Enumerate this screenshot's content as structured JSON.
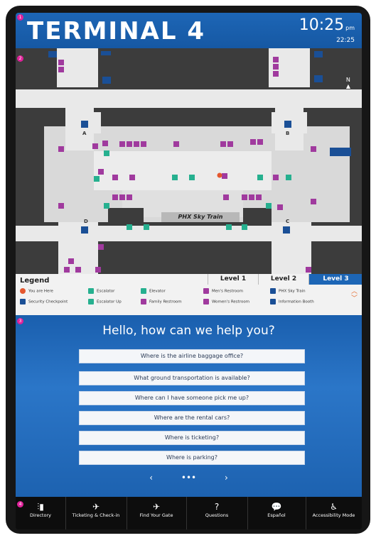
{
  "header": {
    "title": "TERMINAL 4",
    "time": "10:25",
    "ampm": "pm",
    "alt_time": "22:25"
  },
  "markers": [
    "1",
    "2",
    "3",
    "4"
  ],
  "map": {
    "north_label": "N",
    "gates": [
      "A",
      "B",
      "C",
      "D"
    ],
    "ski_store_label": "PHX Sky Train"
  },
  "legend": {
    "title": "Legend",
    "levels": [
      "Level 1",
      "Level 2",
      "Level 3"
    ],
    "active_level": "Level 3",
    "items": [
      {
        "label": "You are Here",
        "color": "#e4572e",
        "icon": "pin-icon"
      },
      {
        "label": "Escalator",
        "color": "#26b08f",
        "icon": "escalator-icon"
      },
      {
        "label": "Elevator",
        "color": "#26b08f",
        "icon": "elevator-icon"
      },
      {
        "label": "Men's Restroom",
        "color": "#a03a9e",
        "icon": "mens-restroom-icon"
      },
      {
        "label": "PHX Sky Train",
        "color": "#1a4f96",
        "icon": "train-icon"
      },
      {
        "label": "Security Checkpoint",
        "color": "#1a4f96",
        "icon": "security-icon"
      },
      {
        "label": "Escalator Up",
        "color": "#26b08f",
        "icon": "escalator-up-icon"
      },
      {
        "label": "Family Restroom",
        "color": "#a03a9e",
        "icon": "family-restroom-icon"
      },
      {
        "label": "Women's Restroom",
        "color": "#a03a9e",
        "icon": "womens-restroom-icon"
      },
      {
        "label": "Information Booth",
        "color": "#1a4f96",
        "icon": "info-icon"
      }
    ]
  },
  "help": {
    "title": "Hello, how can we help you?",
    "questions": [
      "Where is the airline baggage office?",
      "What ground transportation is available?",
      "Where can I have someone pick me up?",
      "Where are the rental cars?",
      "Where is ticketing?",
      "Where is parking?"
    ],
    "prev": "‹",
    "dots": "•••",
    "next": "›"
  },
  "nav": [
    {
      "label": "Directory",
      "icon": "directory-icon",
      "glyph": "⫶▮"
    },
    {
      "label": "Ticketing & Check-in",
      "icon": "ticketing-icon",
      "glyph": "✈︎"
    },
    {
      "label": "Find Your Gate",
      "icon": "airplane-icon",
      "glyph": "✈"
    },
    {
      "label": "Questions",
      "icon": "question-icon",
      "glyph": "?"
    },
    {
      "label": "Español",
      "icon": "language-icon",
      "glyph": "💬"
    },
    {
      "label": "Accessibility Mode",
      "icon": "accessibility-icon",
      "glyph": "♿"
    }
  ],
  "colors": {
    "accent": "#1d66b6",
    "restroom": "#a03a9e",
    "escalator": "#26b08f",
    "security": "#1a4f96",
    "you_are_here": "#e4572e"
  }
}
